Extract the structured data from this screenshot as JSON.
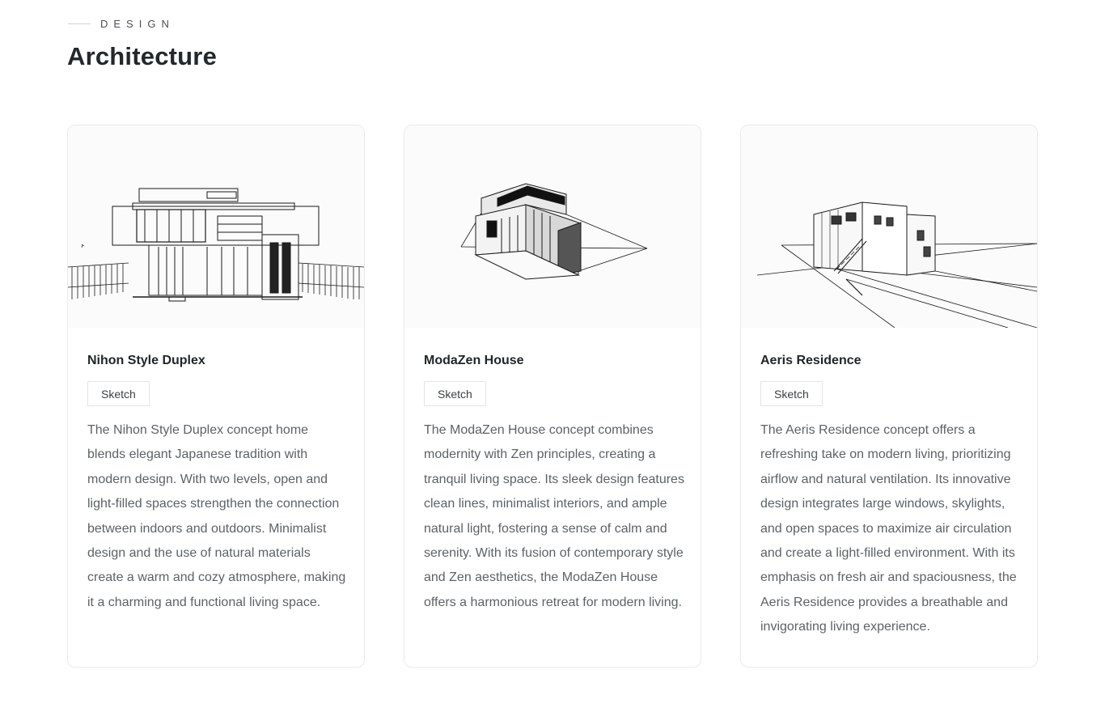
{
  "header": {
    "eyebrow": "DESIGN",
    "title": "Architecture"
  },
  "cards": [
    {
      "title": "Nihon Style Duplex",
      "tag": "Sketch",
      "description": "The Nihon Style Duplex concept home blends elegant Japanese tradition with modern design. With two levels, open and light-filled spaces strengthen the connection between indoors and outdoors. Minimalist design and the use of natural materials create a warm and cozy atmosphere, making it a charming and functional living space.",
      "image_icon": "house-sketch-image"
    },
    {
      "title": "ModaZen House",
      "tag": "Sketch",
      "description": "The ModaZen House concept combines modernity with Zen principles, creating a tranquil living space. Its sleek design features clean lines, minimalist interiors, and ample natural light, fostering a sense of calm and serenity. With its fusion of contemporary style and Zen aesthetics, the ModaZen House offers a harmonious retreat for modern living.",
      "image_icon": "house-sketch-image"
    },
    {
      "title": "Aeris Residence",
      "tag": "Sketch",
      "description": "The Aeris Residence concept offers a refreshing take on modern living, prioritizing airflow and natural ventilation. Its innovative design integrates large windows, skylights, and open spaces to maximize air circulation and create a light-filled environment. With its emphasis on fresh air and spaciousness, the Aeris Residence provides a breathable and invigorating living experience.",
      "image_icon": "house-sketch-image"
    }
  ]
}
